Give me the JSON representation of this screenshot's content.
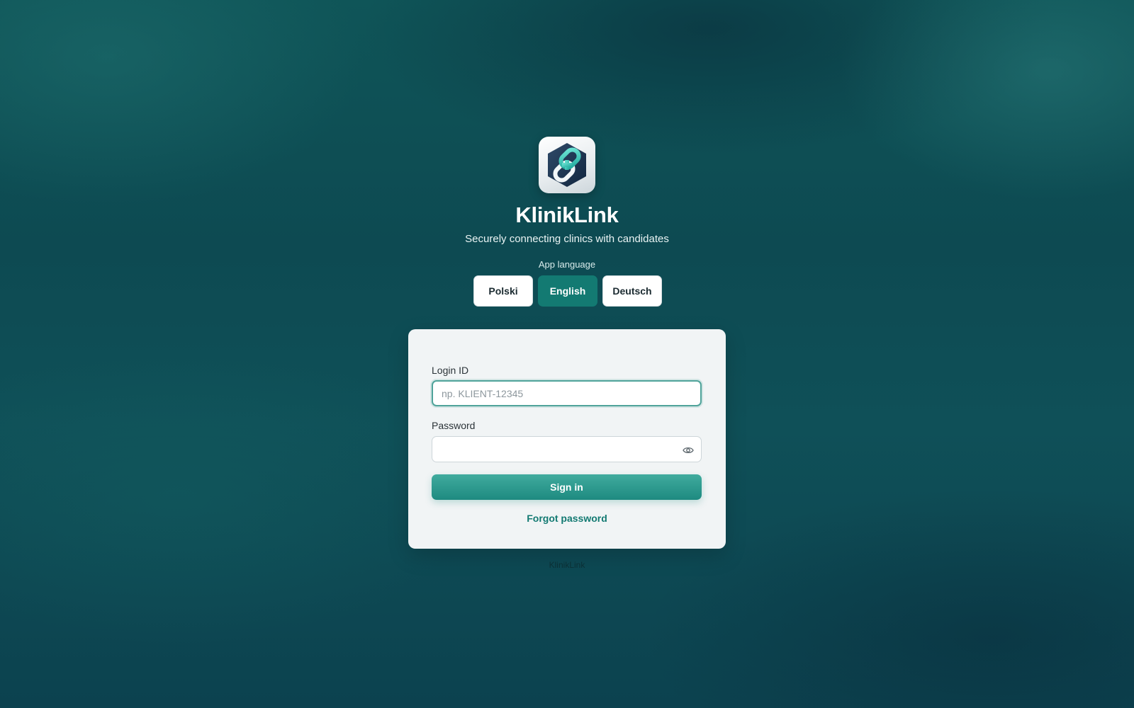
{
  "app": {
    "title": "KlinikLink",
    "subtitle": "Securely connecting clinics with candidates",
    "logo_icon": "chain-link-plus-icon"
  },
  "language": {
    "label": "App language",
    "options": [
      "Polski",
      "English",
      "Deutsch"
    ],
    "selected": "English"
  },
  "login_form": {
    "login_id_label": "Login ID",
    "login_id_placeholder": "np. KLIENT-12345",
    "login_id_value": "",
    "password_label": "Password",
    "password_value": "",
    "show_password_icon": "eye-icon",
    "sign_in_label": "Sign in",
    "forgot_password_label": "Forgot password"
  },
  "footer": {
    "text": "KlinikLink"
  },
  "colors": {
    "accent": "#137a72",
    "button": "#2a9a8e",
    "card": "#f1f4f5"
  }
}
